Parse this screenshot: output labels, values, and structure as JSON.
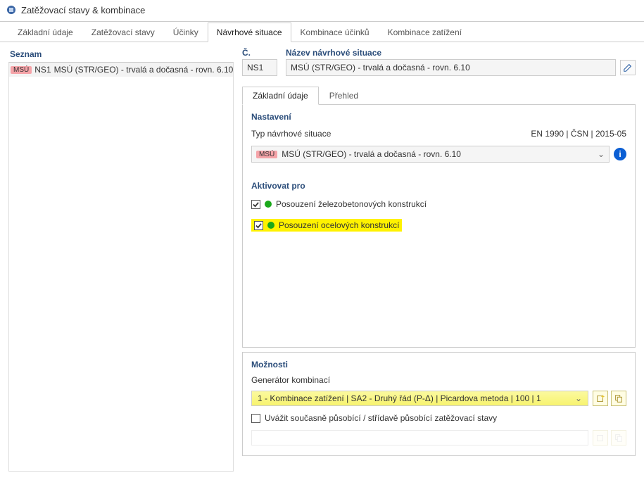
{
  "window": {
    "title": "Zatěžovací stavy & kombinace"
  },
  "tabs": [
    {
      "label": "Základní údaje"
    },
    {
      "label": "Zatěžovací stavy"
    },
    {
      "label": "Účinky"
    },
    {
      "label": "Návrhové situace"
    },
    {
      "label": "Kombinace účinků"
    },
    {
      "label": "Kombinace zatížení"
    }
  ],
  "left": {
    "header": "Seznam",
    "items": [
      {
        "tag": "MSÚ",
        "no": "NS1",
        "name": "MSÚ (STR/GEO) - trvalá a dočasná - rovn. 6.10"
      }
    ]
  },
  "fields": {
    "no_label": "Č.",
    "no_value": "NS1",
    "name_label": "Název návrhové situace",
    "name_value": "MSÚ (STR/GEO) - trvalá a dočasná - rovn. 6.10"
  },
  "subtabs": [
    {
      "label": "Základní údaje"
    },
    {
      "label": "Přehled"
    }
  ],
  "settings": {
    "section": "Nastavení",
    "type_label": "Typ návrhové situace",
    "type_standard": "EN 1990 | ČSN | 2015-05",
    "type_tag": "MSÚ",
    "type_value": "MSÚ (STR/GEO) - trvalá a dočasná - rovn. 6.10"
  },
  "activate": {
    "section": "Aktivovat pro",
    "items": [
      {
        "label": "Posouzení železobetonových konstrukcí",
        "checked": true,
        "highlight": false
      },
      {
        "label": "Posouzení ocelových konstrukcí",
        "checked": true,
        "highlight": true
      }
    ]
  },
  "options": {
    "section": "Možnosti",
    "gen_label": "Generátor kombinací",
    "gen_value": "1 - Kombinace zatížení | SA2 - Druhý řád (P-Δ) | Picardova metoda | 100 | 1",
    "simul_label": "Uvážit současně působící / střídavě působící zatěžovací stavy",
    "simul_checked": false
  },
  "icons": {
    "edit": "edit-name",
    "info": "i",
    "new": "new",
    "copy": "copy"
  }
}
